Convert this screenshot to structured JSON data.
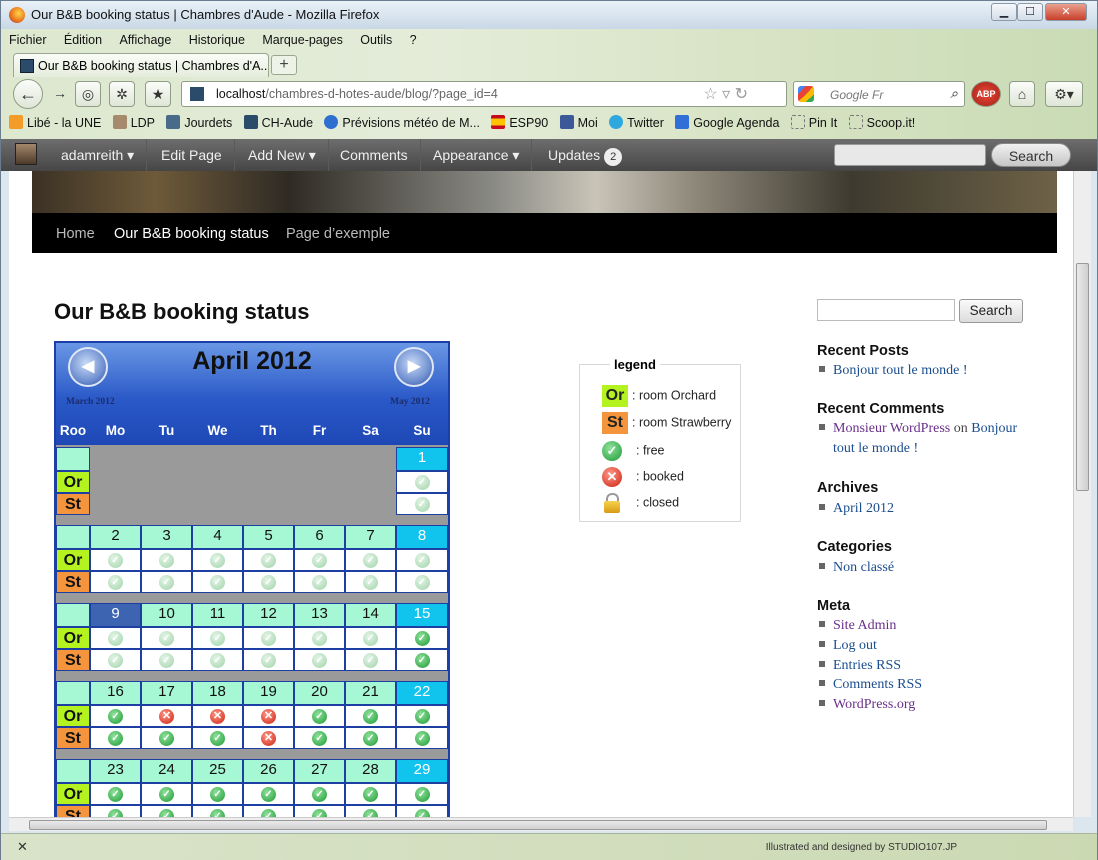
{
  "window": {
    "title": "Our B&B booking status | Chambres d'Aude - Mozilla Firefox",
    "min": "▁",
    "max": "☐",
    "close": "✕"
  },
  "menu": [
    "Fichier",
    "Édition",
    "Affichage",
    "Historique",
    "Marque-pages",
    "Outils",
    "?"
  ],
  "tab": {
    "label": "Our B&B booking status | Chambres d'A...",
    "new": "+"
  },
  "url": {
    "host": "localhost",
    "path": "/chambres-d-hotes-aude/blog/?page_id=4"
  },
  "search": {
    "placeholder": "Google Fr"
  },
  "bookmarks": [
    "Libé - la UNE",
    "LDP",
    "Jourdets",
    "CH-Aude",
    "Prévisions météo de M...",
    "ESP90",
    "Moi",
    "Twitter",
    "Google Agenda",
    "Pin It",
    "Scoop.it!"
  ],
  "admin": {
    "user": "adamreith ▾",
    "edit": "Edit Page",
    "add": "Add New ▾",
    "comments": "Comments",
    "appearance": "Appearance ▾",
    "updates": "Updates",
    "updates_count": "2",
    "search_btn": "Search"
  },
  "sitenav": [
    "Home",
    "Our B&B booking status",
    "Page d’exemple"
  ],
  "page": {
    "title": "Our B&B booking status"
  },
  "calendar": {
    "month": "April 2012",
    "prev": "March 2012",
    "next": "May 2012",
    "headers": [
      "Roo",
      "Mo",
      "Tu",
      "We",
      "Th",
      "Fr",
      "Sa",
      "Su"
    ],
    "rooms": [
      "Or",
      "St"
    ],
    "weeks": [
      {
        "days": [
          "",
          "",
          "",
          "",
          "",
          "",
          "1"
        ],
        "or": [
          "",
          "",
          "",
          "",
          "",
          "",
          "free-pale"
        ],
        "st": [
          "",
          "",
          "",
          "",
          "",
          "",
          "free-pale"
        ]
      },
      {
        "days": [
          "2",
          "3",
          "4",
          "5",
          "6",
          "7",
          "8"
        ],
        "or": [
          "free-pale",
          "free-pale",
          "free-pale",
          "free-pale",
          "free-pale",
          "free-pale",
          "free-pale"
        ],
        "st": [
          "free-pale",
          "free-pale",
          "free-pale",
          "free-pale",
          "free-pale",
          "free-pale",
          "free-pale"
        ]
      },
      {
        "days": [
          "9",
          "10",
          "11",
          "12",
          "13",
          "14",
          "15"
        ],
        "or": [
          "free-pale",
          "free-pale",
          "free-pale",
          "free-pale",
          "free-pale",
          "free-pale",
          "free"
        ],
        "st": [
          "free-pale",
          "free-pale",
          "free-pale",
          "free-pale",
          "free-pale",
          "free-pale",
          "free"
        ]
      },
      {
        "days": [
          "16",
          "17",
          "18",
          "19",
          "20",
          "21",
          "22"
        ],
        "or": [
          "free",
          "booked",
          "booked",
          "booked",
          "free",
          "free",
          "free"
        ],
        "st": [
          "free",
          "free",
          "free",
          "booked",
          "free",
          "free",
          "free"
        ]
      },
      {
        "days": [
          "23",
          "24",
          "25",
          "26",
          "27",
          "28",
          "29"
        ],
        "or": [
          "free",
          "free",
          "free",
          "free",
          "free",
          "free",
          "free"
        ],
        "st": [
          "free",
          "free",
          "free",
          "free",
          "free",
          "free",
          "free"
        ]
      }
    ]
  },
  "legend": {
    "title": "legend",
    "or": ": room Orchard",
    "st": ": room Strawberry",
    "free": ": free",
    "booked": ": booked",
    "closed": ": closed"
  },
  "sidebar": {
    "search_btn": "Search",
    "recent_posts": {
      "title": "Recent Posts",
      "items": [
        "Bonjour tout le monde !"
      ]
    },
    "recent_comments": {
      "title": "Recent Comments",
      "author": "Monsieur WordPress",
      "on": "on",
      "post": "Bonjour tout le monde !"
    },
    "archives": {
      "title": "Archives",
      "items": [
        "April 2012"
      ]
    },
    "categories": {
      "title": "Categories",
      "items": [
        "Non classé"
      ]
    },
    "meta": {
      "title": "Meta",
      "items": [
        "Site Admin",
        "Log out",
        "Entries RSS",
        "Comments RSS",
        "WordPress.org"
      ]
    }
  },
  "status": {
    "close": "✕",
    "credit": "Illustrated and designed by STUDIO107.JP"
  }
}
